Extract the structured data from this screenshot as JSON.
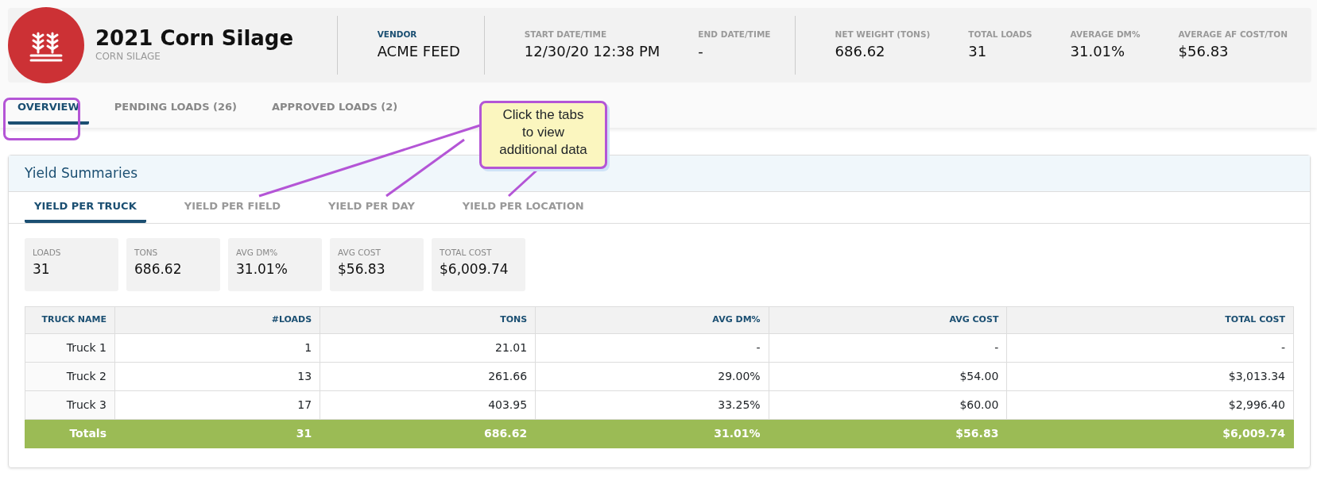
{
  "record": {
    "title": "2021 Corn Silage",
    "subtitle": "CORN SILAGE"
  },
  "header_groups": [
    [
      {
        "label": "VENDOR",
        "value": "ACME FEED",
        "highlighted": true
      }
    ],
    [
      {
        "label": "START DATE/TIME",
        "value": "12/30/20 12:38 PM",
        "highlighted": false
      },
      {
        "label": "END DATE/TIME",
        "value": "-",
        "highlighted": false
      }
    ],
    [
      {
        "label": "NET WEIGHT (TONS)",
        "value": "686.62",
        "highlighted": false
      },
      {
        "label": "TOTAL LOADS",
        "value": "31",
        "highlighted": false
      },
      {
        "label": "AVERAGE DM%",
        "value": "31.01%",
        "highlighted": false
      },
      {
        "label": "AVERAGE AF COST/TON",
        "value": "$56.83",
        "highlighted": false
      }
    ]
  ],
  "tabs": [
    {
      "label": "OVERVIEW",
      "selected": true
    },
    {
      "label": "PENDING LOADS (26)",
      "selected": false
    },
    {
      "label": "APPROVED LOADS (2)",
      "selected": false
    }
  ],
  "callout": {
    "text": "Click the tabs to view additional data"
  },
  "panel": {
    "title": "Yield Summaries",
    "tabs": [
      {
        "label": "YIELD PER TRUCK",
        "selected": true
      },
      {
        "label": "YIELD PER FIELD",
        "selected": false
      },
      {
        "label": "YIELD PER DAY",
        "selected": false
      },
      {
        "label": "YIELD PER LOCATION",
        "selected": false
      }
    ],
    "stats": [
      {
        "label": "LOADS",
        "value": "31"
      },
      {
        "label": "TONS",
        "value": "686.62"
      },
      {
        "label": "AVG DM%",
        "value": "31.01%"
      },
      {
        "label": "AVG COST",
        "value": "$56.83"
      },
      {
        "label": "TOTAL COST",
        "value": "$6,009.74"
      }
    ],
    "table": {
      "columns": [
        "TRUCK NAME",
        "#LOADS",
        "TONS",
        "AVG DM%",
        "AVG COST",
        "TOTAL COST"
      ],
      "rows": [
        [
          "Truck 1",
          "1",
          "21.01",
          "-",
          "-",
          "-"
        ],
        [
          "Truck 2",
          "13",
          "261.66",
          "29.00%",
          "$54.00",
          "$3,013.34"
        ],
        [
          "Truck 3",
          "17",
          "403.95",
          "33.25%",
          "$60.00",
          "$2,996.40"
        ]
      ],
      "totals": [
        "Totals",
        "31",
        "686.62",
        "31.01%",
        "$56.83",
        "$6,009.74"
      ]
    }
  }
}
